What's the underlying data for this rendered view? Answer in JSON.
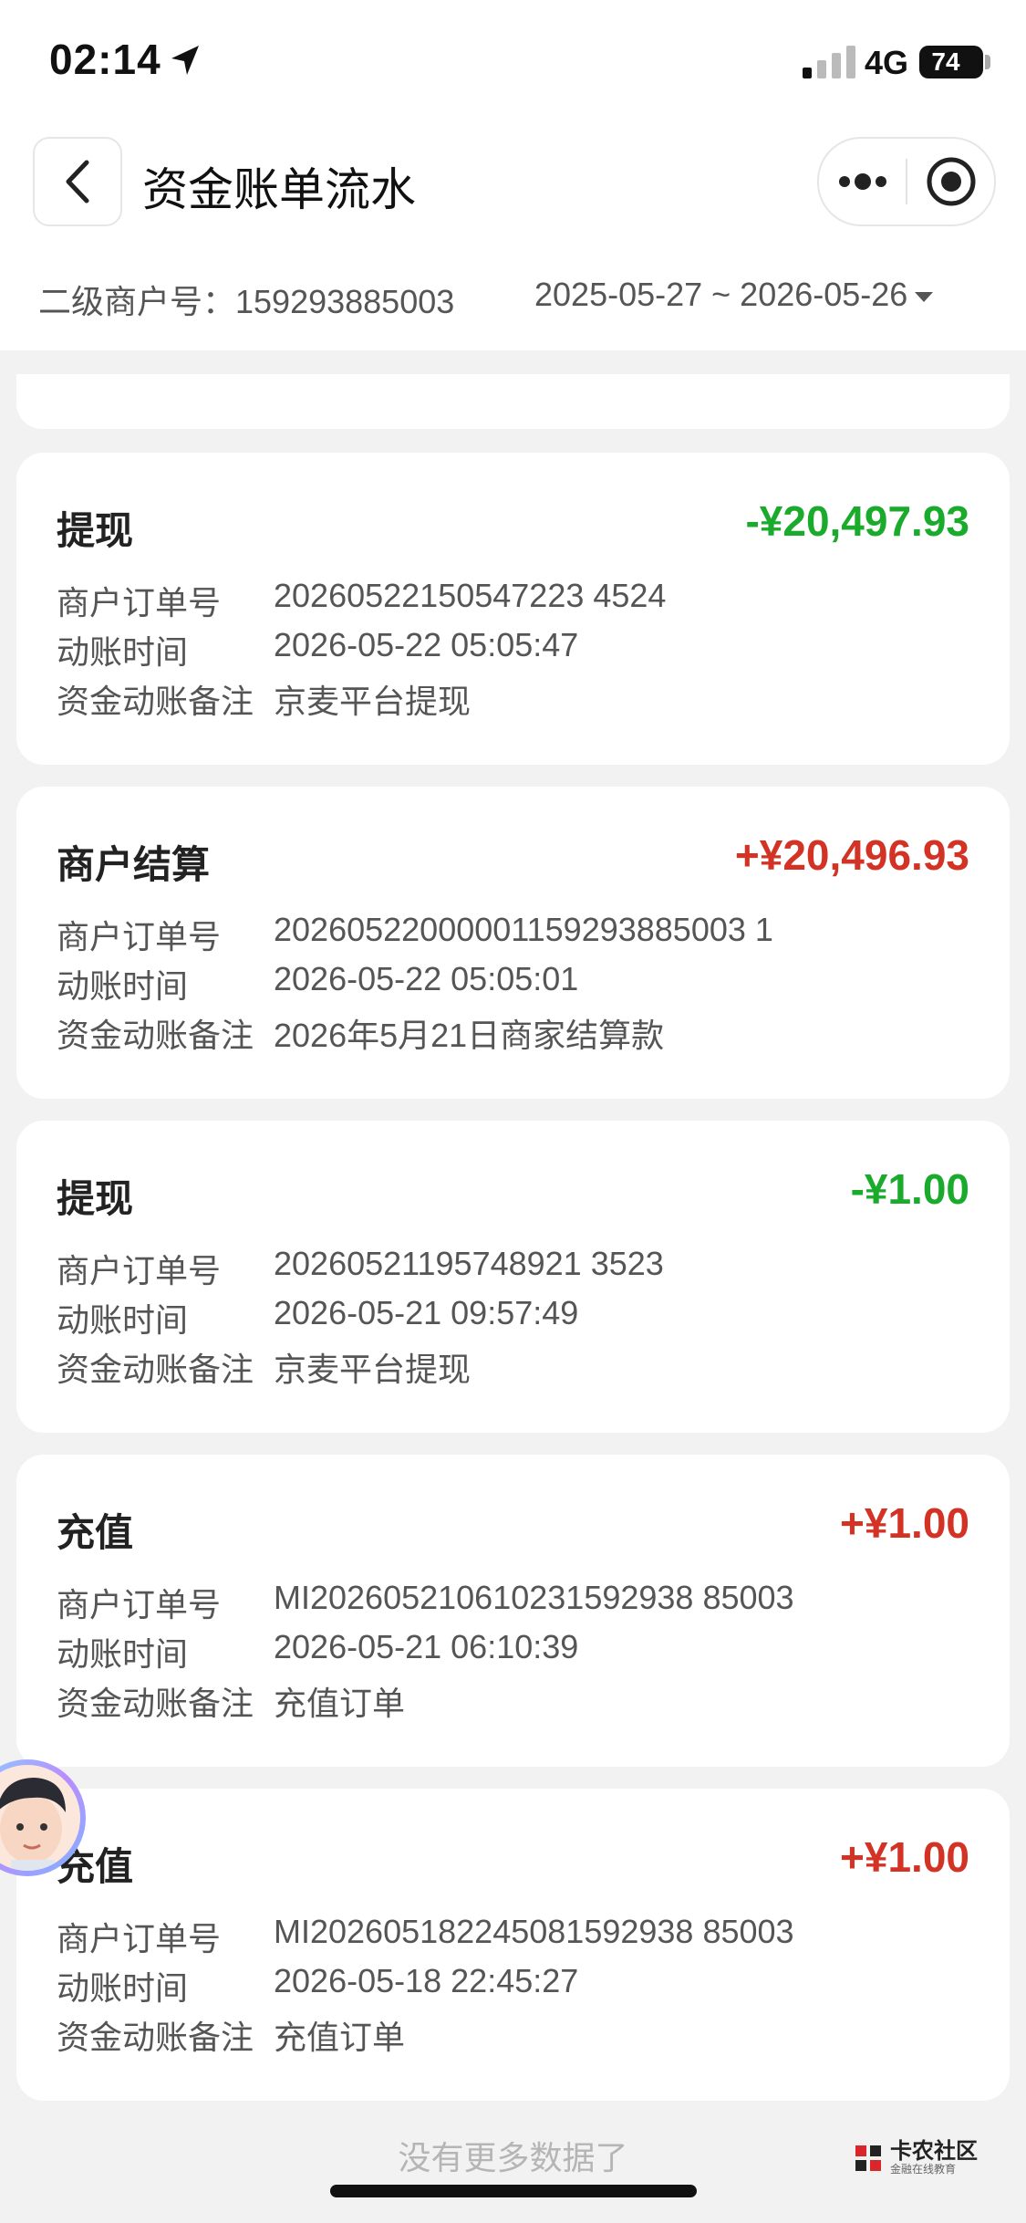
{
  "status_bar": {
    "time": "02:14",
    "network": "4G",
    "battery": "74"
  },
  "nav": {
    "title": "资金账单流水"
  },
  "filter": {
    "merchant_label": "二级商户号：159293885003",
    "date_range": "2025-05-27 ~ 2026-05-26"
  },
  "labels": {
    "order_no": "商户订单号",
    "time": "动账时间",
    "remark": "资金动账备注"
  },
  "records": [
    {
      "type": "提现",
      "amount": "-¥20,497.93",
      "order_no": "20260522150547223 4524",
      "time": "2026-05-22 05:05:47",
      "remark": "京麦平台提现"
    },
    {
      "type": "商户结算",
      "amount": "+¥20,496.93",
      "order_no": "20260522000001159293885003 1",
      "time": "2026-05-22 05:05:01",
      "remark": "2026年5月21日商家结算款"
    },
    {
      "type": "提现",
      "amount": "-¥1.00",
      "order_no": "20260521195748921 3523",
      "time": "2026-05-21 09:57:49",
      "remark": "京麦平台提现"
    },
    {
      "type": "充值",
      "amount": "+¥1.00",
      "order_no": "MI202605210610231592938 85003",
      "time": "2026-05-21 06:10:39",
      "remark": "充值订单"
    },
    {
      "type": "充值",
      "amount": "+¥1.00",
      "order_no": "MI202605182245081592938 85003",
      "time": "2026-05-18 22:45:27",
      "remark": "充值订单"
    }
  ],
  "footer": {
    "no_more": "没有更多数据了"
  },
  "watermark": {
    "name": "卡农社区",
    "tagline": "金融在线教育"
  }
}
